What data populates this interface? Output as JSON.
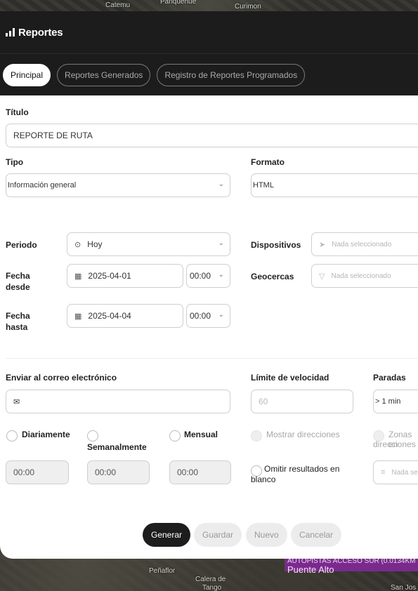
{
  "map": {
    "labels": [
      "Catemu",
      "Panquehue",
      "Curimon",
      "Peñaflor",
      "Calera de",
      "Tango",
      "Puente Alto",
      "San Jos"
    ],
    "route_tag": [
      "AUTOPISTAS ACCESO SUR (0.0134KM"
    ]
  },
  "header": {
    "title": "Reportes",
    "icon": "bar-chart-icon"
  },
  "tabs": [
    {
      "label": "Principal",
      "active": true
    },
    {
      "label": "Reportes Generados",
      "active": false
    },
    {
      "label": "Registro de Reportes Programados",
      "active": false
    }
  ],
  "form": {
    "titulo": {
      "label": "Título",
      "value": "REPORTE DE RUTA"
    },
    "tipo": {
      "label": "Tipo",
      "value": "Información general"
    },
    "formato": {
      "label": "Formato",
      "value": "HTML"
    },
    "periodo": {
      "label": "Periodo",
      "value": "Hoy"
    },
    "dispositivos": {
      "label": "Dispositivos",
      "placeholder": "Nada seleccionado"
    },
    "fecha_desde": {
      "label_1": "Fecha",
      "label_2": "desde",
      "date": "2025-04-01",
      "time": "00:00"
    },
    "geocercas": {
      "label": "Geocercas",
      "placeholder": "Nada seleccionado"
    },
    "fecha_hasta": {
      "label_1": "Fecha",
      "label_2": "hasta",
      "date": "2025-04-04",
      "time": "00:00"
    },
    "correo": {
      "label": "Enviar al correo electrónico",
      "value": ""
    },
    "limite_velocidad": {
      "label": "Límite de velocidad",
      "placeholder": "60"
    },
    "paradas": {
      "label": "Paradas",
      "value": "> 1 min"
    },
    "frecuencia": {
      "diariamente": {
        "label": "Diariamente",
        "time": "00:00"
      },
      "semanalmente": {
        "label": "Semanalmente",
        "time": "00:00"
      },
      "mensual": {
        "label": "Mensual",
        "time": "00:00"
      }
    },
    "mostrar_direcciones": {
      "label": "Mostrar direcciones"
    },
    "zonas_direcciones": {
      "label_1": "Zonas en",
      "label_2": "direcciones",
      "placeholder": "Nada se"
    },
    "omitir_resultados": {
      "label_1": "Omitir resultados en",
      "label_2": "blanco"
    }
  },
  "actions": {
    "generar": "Generar",
    "guardar": "Guardar",
    "nuevo": "Nuevo",
    "cancelar": "Cancelar"
  }
}
